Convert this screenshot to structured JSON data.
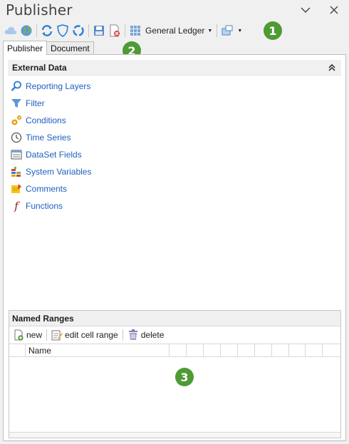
{
  "pane": {
    "title": "Publisher"
  },
  "toolbar": {
    "ledger_label": "General Ledger",
    "icons": [
      "cloud-icon",
      "globe-icon",
      "refresh-icon",
      "shield-icon",
      "sync-icon",
      "save-icon",
      "delete-document-icon",
      "grid-icon",
      "window-add-icon"
    ]
  },
  "tabs": [
    {
      "label": "Publisher",
      "active": true
    },
    {
      "label": "Document",
      "active": false
    }
  ],
  "external_data": {
    "title": "External Data",
    "items": [
      {
        "label": "Reporting Layers",
        "icon": "magnifier-icon"
      },
      {
        "label": "Filter",
        "icon": "filter-icon"
      },
      {
        "label": "Conditions",
        "icon": "gears-icon"
      },
      {
        "label": "Time Series",
        "icon": "clock-icon"
      },
      {
        "label": "DataSet Fields",
        "icon": "dataset-icon"
      },
      {
        "label": "System Variables",
        "icon": "variables-icon"
      },
      {
        "label": "Comments",
        "icon": "comment-icon"
      },
      {
        "label": "Functions",
        "icon": "function-icon"
      }
    ]
  },
  "named_ranges": {
    "title": "Named Ranges",
    "new_label": "new",
    "edit_label": "edit cell range",
    "delete_label": "delete",
    "column_name": "Name"
  },
  "badges": [
    "1",
    "2",
    "3"
  ],
  "colors": {
    "badge": "#4e9a35",
    "link": "#1f5fbf",
    "accent": "#2a7fd4"
  }
}
